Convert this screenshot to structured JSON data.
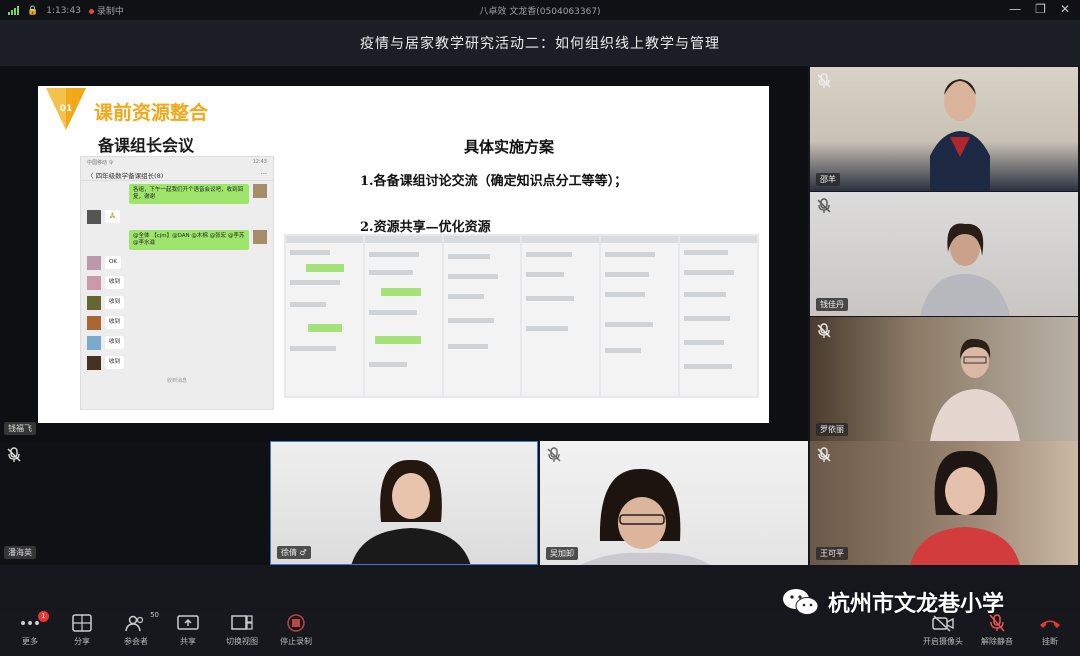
{
  "statusbar": {
    "time": "1:13:43",
    "recording": "录制中",
    "center": "八卓效 文龙香(0504063367)"
  },
  "titlebar": {
    "title": "疫情与居家教学研究活动二：如何组织线上教学与管理"
  },
  "slide": {
    "badge": "01",
    "heading": "课前资源整合",
    "subheading": "备课组长会议",
    "plan_title": "具体实施方案",
    "line1": "1.各备课组讨论交流（确定知识点分工等等）；",
    "line2": "2.资源共享—优化资源",
    "phone": {
      "status_left": "中国移动 令",
      "status_right": "12:43",
      "chat_title": "〈  四年级数学备课组长(8)",
      "msg1": "各组，下午一起我们开个语音会议吧，收到回复，谢谢",
      "msg2": "🙏",
      "msg3": "@全体 【cjm】@DAN @木棉 @张宏 @李苏 @李水滋",
      "replies": [
        "OK",
        "收到",
        "收到",
        "收到",
        "收到",
        "收到"
      ],
      "footer": "收到消息"
    }
  },
  "stage_tags": {
    "left_top": "钱福飞",
    "left_bottom": "潘海英"
  },
  "participants": [
    {
      "name": "邵羊",
      "muted": true
    },
    {
      "name": "钱佳丹",
      "muted": true
    },
    {
      "name": "罗依丽",
      "muted": true
    },
    {
      "name": "王可平",
      "muted": true
    }
  ],
  "thumbs": [
    {
      "name": "徐倩 ♂",
      "muted": false
    },
    {
      "name": "吴加卸",
      "muted": true
    }
  ],
  "toolbar": {
    "items": [
      {
        "label": "更多",
        "badge": "1"
      },
      {
        "label": "分享"
      },
      {
        "label": "参会者",
        "count": "50"
      },
      {
        "label": "共享"
      },
      {
        "label": "切换视图"
      },
      {
        "label": "停止录制"
      }
    ],
    "right_items": [
      {
        "label": "开启摄像头"
      },
      {
        "label": "解除静音"
      },
      {
        "label": "挂断"
      }
    ]
  },
  "watermark": "杭州市文龙巷小学",
  "colors": {
    "accent": "#f3a81b",
    "mic_off": "#e0e0e0",
    "hangup": "#e53935"
  }
}
